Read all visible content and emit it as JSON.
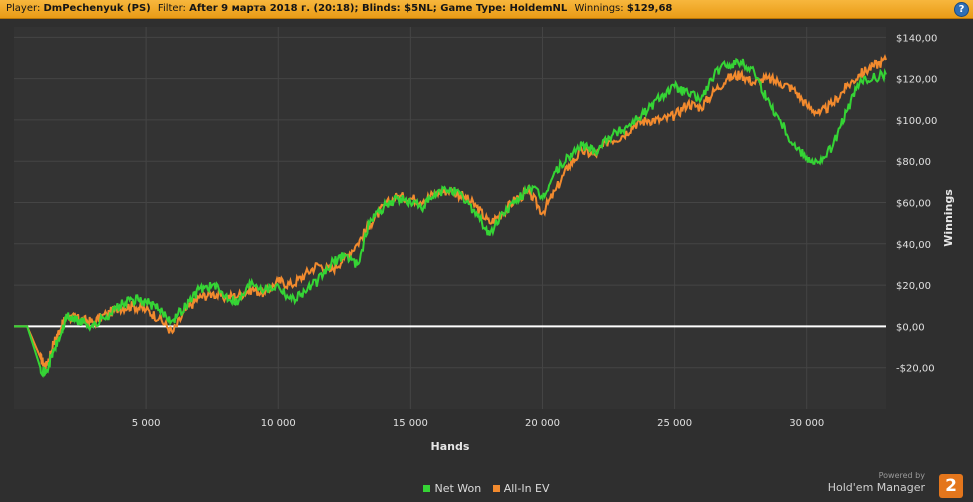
{
  "header": {
    "player_label": "Player:",
    "player_value": "DmPechenyuk (PS)",
    "filter_label": "Filter:",
    "filter_value": "After 9 марта 2018 г. (20:18); Blinds: $5NL; Game Type: HoldemNL",
    "winnings_label": "Winnings:",
    "winnings_value": "$129,68",
    "help_glyph": "?"
  },
  "branding": {
    "powered_by": "Powered by",
    "product": "Hold'em Manager",
    "badge": "2"
  },
  "colors": {
    "background": "#2f2f2f",
    "plot_background": "#333333",
    "grid": "#454545",
    "zero_line": "#ffffff",
    "net_won": "#35d435",
    "all_in_ev": "#f28a2e",
    "accent_bar": "#f0a82a"
  },
  "chart_data": {
    "type": "line",
    "title": "",
    "xlabel": "Hands",
    "ylabel": "Winnings",
    "xlim": [
      0,
      33000
    ],
    "ylim": [
      -40,
      145
    ],
    "x_ticks": [
      5000,
      10000,
      15000,
      20000,
      25000,
      30000
    ],
    "x_tick_labels": [
      "5 000",
      "10 000",
      "15 000",
      "20 000",
      "25 000",
      "30 000"
    ],
    "y_ticks": [
      -20,
      0,
      20,
      40,
      60,
      80,
      100,
      120,
      140
    ],
    "y_tick_labels": [
      "-$20,00",
      "$0,00",
      "$20,00",
      "$40,00",
      "$60,00",
      "$80,00",
      "$100,00",
      "$120,00",
      "$140,00"
    ],
    "grid": true,
    "legend_position": "bottom-center",
    "x": [
      0,
      500,
      1000,
      1200,
      1500,
      1800,
      2000,
      2300,
      2600,
      3000,
      3500,
      4000,
      4500,
      5000,
      5500,
      6000,
      6500,
      7000,
      7500,
      8000,
      8500,
      9000,
      9500,
      10000,
      10500,
      11000,
      11500,
      12000,
      12500,
      13000,
      13500,
      14000,
      14500,
      15000,
      15500,
      16000,
      16500,
      17000,
      17500,
      18000,
      18500,
      19000,
      19500,
      20000,
      20500,
      21000,
      21500,
      22000,
      22500,
      23000,
      23500,
      24000,
      24500,
      25000,
      25500,
      26000,
      26500,
      27000,
      27500,
      28000,
      28500,
      29000,
      29500,
      30000,
      30500,
      31000,
      31500,
      32000,
      32500,
      33000
    ],
    "series": [
      {
        "name": "Net Won",
        "color": "#35d435",
        "values": [
          0,
          0,
          -20,
          -23,
          -12,
          -3,
          5,
          3,
          2,
          0,
          5,
          10,
          13,
          12,
          8,
          3,
          10,
          18,
          20,
          15,
          12,
          22,
          18,
          20,
          13,
          17,
          22,
          30,
          35,
          30,
          52,
          58,
          62,
          60,
          58,
          64,
          67,
          62,
          55,
          44,
          55,
          60,
          68,
          62,
          75,
          82,
          88,
          85,
          92,
          95,
          100,
          105,
          112,
          116,
          113,
          110,
          122,
          127,
          128,
          124,
          110,
          100,
          88,
          82,
          79,
          88,
          104,
          118,
          120,
          122
        ]
      },
      {
        "name": "All-In EV",
        "color": "#f28a2e",
        "values": [
          0,
          0,
          -15,
          -20,
          -8,
          0,
          5,
          4,
          3,
          2,
          6,
          9,
          10,
          8,
          4,
          -3,
          8,
          14,
          16,
          14,
          15,
          18,
          16,
          22,
          20,
          25,
          30,
          27,
          33,
          40,
          50,
          58,
          63,
          62,
          61,
          65,
          66,
          63,
          58,
          50,
          55,
          62,
          65,
          55,
          66,
          78,
          85,
          83,
          90,
          92,
          98,
          100,
          100,
          102,
          108,
          106,
          114,
          120,
          122,
          118,
          120,
          118,
          115,
          107,
          103,
          108,
          116,
          122,
          126,
          129
        ]
      }
    ]
  }
}
